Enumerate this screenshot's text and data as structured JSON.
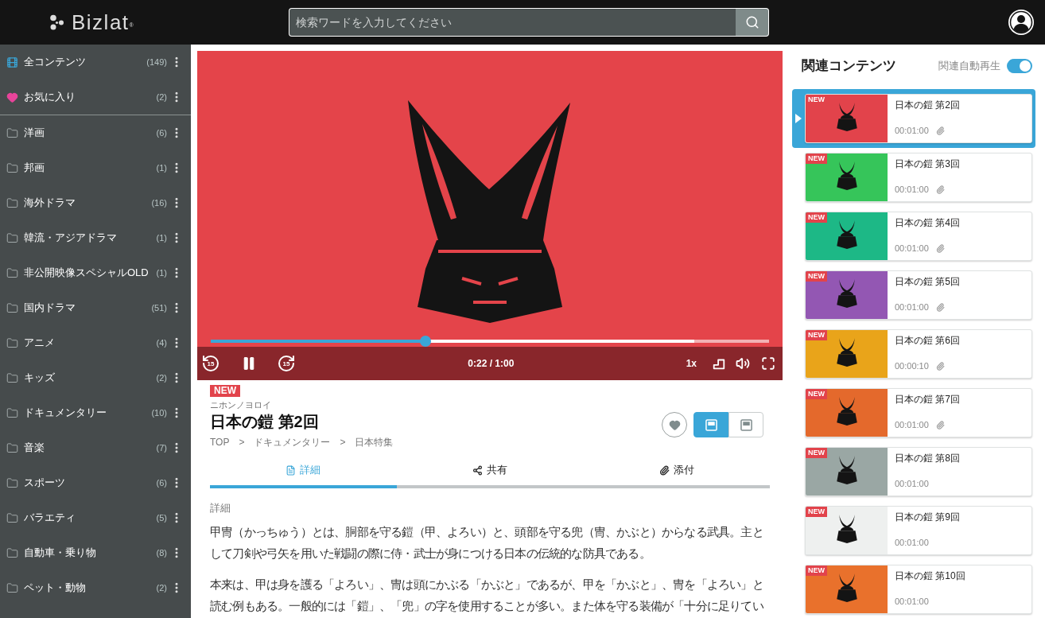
{
  "header": {
    "logo": {
      "text": "Bizlat",
      "mark": "®"
    },
    "search": {
      "placeholder": "検索ワードを入力してください"
    }
  },
  "sidebar": {
    "pinned": [
      {
        "kind": "all",
        "label": "全コンテンツ",
        "count": "(149)"
      },
      {
        "kind": "favorites",
        "label": "お気に入り",
        "count": "(2)"
      }
    ],
    "folders": [
      {
        "label": "洋画",
        "count": "(6)"
      },
      {
        "label": "邦画",
        "count": "(1)"
      },
      {
        "label": "海外ドラマ",
        "count": "(16)"
      },
      {
        "label": "韓流・アジアドラマ",
        "count": "(1)"
      },
      {
        "label": "非公開映像スペシャルOLD",
        "count": "(1)"
      },
      {
        "label": "国内ドラマ",
        "count": "(51)"
      },
      {
        "label": "アニメ",
        "count": "(4)"
      },
      {
        "label": "キッズ",
        "count": "(2)"
      },
      {
        "label": "ドキュメンタリー",
        "count": "(10)"
      },
      {
        "label": "音楽",
        "count": "(7)"
      },
      {
        "label": "スポーツ",
        "count": "(6)"
      },
      {
        "label": "バラエティ",
        "count": "(5)"
      },
      {
        "label": "自動車・乗り物",
        "count": "(8)"
      },
      {
        "label": "ペット・動物",
        "count": "(2)"
      }
    ]
  },
  "video": {
    "playing": true,
    "progress": {
      "level": 0.385
    },
    "buffer": {
      "level": 0.866
    },
    "rewind": "15",
    "forward": "15",
    "time": "0:22 / 1:00",
    "speed": "1x"
  },
  "info": {
    "badge": "NEW",
    "reading": "ニホンノヨロイ",
    "title": "日本の鎧 第2回",
    "breadcrumb": [
      {
        "label": "TOP",
        "separator": ">"
      },
      {
        "label": "ドキュメンタリー",
        "separator": ">"
      },
      {
        "label": "日本特集"
      }
    ],
    "favorited": false,
    "view_modes": [
      {
        "selected": true
      },
      {
        "selected": false
      }
    ]
  },
  "tabs": [
    {
      "label": "詳細",
      "selected": true
    },
    {
      "label": "共有",
      "selected": false
    },
    {
      "label": "添付",
      "selected": false
    }
  ],
  "details": {
    "heading": "詳細",
    "paragraphs": [
      "甲冑（かっちゅう）とは、胴部を守る鎧（甲、よろい）と、頭部を守る兜（冑、かぶと）からなる武具。主として刀剣や弓矢を用いた戦闘の際に侍・武士が身につける日本の伝統的な防具である。",
      "本来は、甲は身を護る「よろい」、冑は頭にかぶる「かぶと」であるが、甲を「かぶと」、冑を「よろい」と読む例もある。一般的には「鎧」、「兜」の字を使用することが多い。また体を守る装備が「十分に足りてい"
    ]
  },
  "related": {
    "title": "関連コンテンツ",
    "autoplay": {
      "label": "関連自動再生",
      "on": true
    },
    "items": [
      {
        "badge": "NEW",
        "title": "日本の鎧 第2回",
        "duration": "00:01:00",
        "attachment": true,
        "color": "#e2434b",
        "selected": true
      },
      {
        "badge": "NEW",
        "title": "日本の鎧 第3回",
        "duration": "00:01:00",
        "attachment": true,
        "color": "#36c55a",
        "selected": false
      },
      {
        "badge": "NEW",
        "title": "日本の鎧 第4回",
        "duration": "00:01:00",
        "attachment": true,
        "color": "#1db886",
        "selected": false
      },
      {
        "badge": "NEW",
        "title": "日本の鎧 第5回",
        "duration": "00:01:00",
        "attachment": true,
        "color": "#9357b3",
        "selected": false
      },
      {
        "badge": "NEW",
        "title": "日本の鎧 第6回",
        "duration": "00:00:10",
        "attachment": true,
        "color": "#e9a41a",
        "selected": false
      },
      {
        "badge": "NEW",
        "title": "日本の鎧 第7回",
        "duration": "00:01:00",
        "attachment": true,
        "color": "#e4692c",
        "selected": false
      },
      {
        "badge": "NEW",
        "title": "日本の鎧 第8回",
        "duration": "00:01:00",
        "attachment": false,
        "color": "#9aa7a4",
        "selected": false
      },
      {
        "badge": "NEW",
        "title": "日本の鎧 第9回",
        "duration": "00:01:00",
        "attachment": false,
        "color": "#eef0ef",
        "selected": false
      },
      {
        "badge": "NEW",
        "title": "日本の鎧 第10回",
        "duration": "00:01:00",
        "attachment": false,
        "color": "#e9712c",
        "selected": false
      }
    ]
  }
}
